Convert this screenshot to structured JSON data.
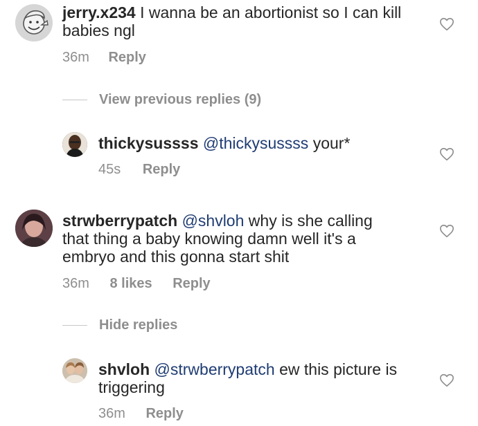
{
  "comments": [
    {
      "username": "jerry.x234",
      "mention": "",
      "text": " I wanna be an abortionist so I can kill babies ngl",
      "time": "36m",
      "likes": "",
      "reply_label": "Reply",
      "avatar_icon": "vault-boy-avatar",
      "like_icon": "heart-outline-icon"
    },
    {
      "username": "thickysussss",
      "mention": "@thickysussss",
      "text": " your*",
      "time": "45s",
      "likes": "",
      "reply_label": "Reply",
      "avatar_icon": "user-photo-avatar",
      "like_icon": "heart-outline-icon"
    },
    {
      "username": "strwberrypatch",
      "mention": "@shvloh",
      "text": " why is she calling that thing a baby knowing damn well it's a embryo and this gonna start shit",
      "time": "36m",
      "likes": "8 likes",
      "reply_label": "Reply",
      "avatar_icon": "user-photo-avatar",
      "like_icon": "heart-outline-icon"
    },
    {
      "username": "shvloh",
      "mention": "@strwberrypatch",
      "text": " ew this picture is triggering",
      "time": "36m",
      "likes": "",
      "reply_label": "Reply",
      "avatar_icon": "user-photo-avatar",
      "like_icon": "heart-outline-icon"
    }
  ],
  "threads": {
    "view_previous": "View previous replies (9)",
    "hide_replies": "Hide replies"
  },
  "colors": {
    "text": "#262626",
    "muted": "#8e8e8e",
    "mention": "#1f3c73",
    "divider": "#c7c7c7"
  }
}
